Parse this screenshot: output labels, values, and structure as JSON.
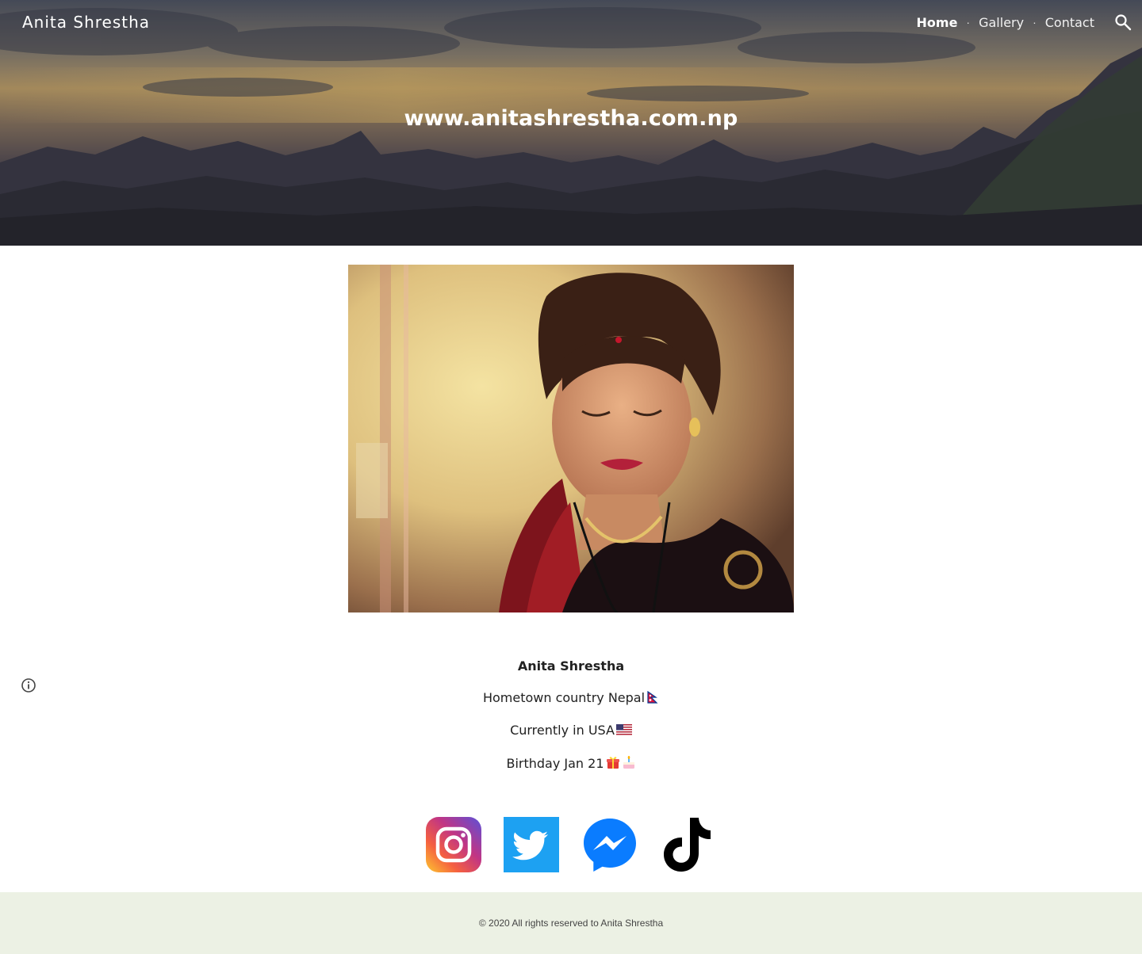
{
  "header": {
    "site_title": "Anita Shrestha",
    "nav": [
      {
        "label": "Home",
        "active": true
      },
      {
        "label": "Gallery",
        "active": false
      },
      {
        "label": "Contact",
        "active": false
      }
    ],
    "search_icon": "search-icon"
  },
  "hero": {
    "heading": "www.anitashrestha.com.np"
  },
  "main": {
    "portrait_alt": "portrait photo",
    "name": "Anita Shrestha",
    "lines": [
      {
        "text": "Hometown country Nepal",
        "emoji": [
          "nepal-flag-emoji"
        ]
      },
      {
        "text": "Currently in USA",
        "emoji": [
          "us-flag-emoji"
        ]
      },
      {
        "text": "Birthday Jan 21",
        "emoji": [
          "gift-emoji",
          "birthday-cake-emoji"
        ]
      }
    ],
    "social": [
      {
        "name": "instagram-icon"
      },
      {
        "name": "twitter-icon"
      },
      {
        "name": "messenger-icon"
      },
      {
        "name": "tiktok-icon"
      }
    ]
  },
  "footer": {
    "text": "© 2020 All rights reserved to Anita Shrestha"
  },
  "colors": {
    "footer_bg": "#ecf1e4",
    "twitter_blue": "#1da1f2",
    "messenger_blue": "#0a7cff"
  }
}
